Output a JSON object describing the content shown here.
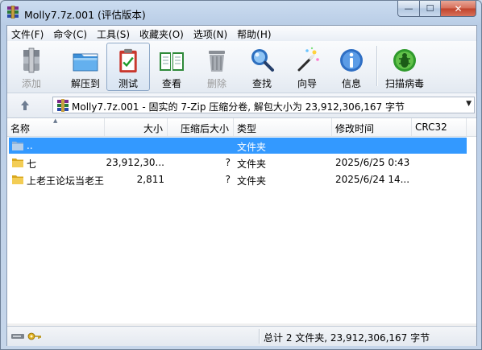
{
  "window": {
    "title": "Molly7.7z.001 (评估版本)",
    "minimize_glyph": "—",
    "maximize_glyph": "☐",
    "close_glyph": "✕"
  },
  "menu": [
    "文件(F)",
    "命令(C)",
    "工具(S)",
    "收藏夹(O)",
    "选项(N)",
    "帮助(H)"
  ],
  "toolbar": {
    "add": "添加",
    "extract": "解压到",
    "test": "测试",
    "view": "查看",
    "delete": "删除",
    "find": "查找",
    "wizard": "向导",
    "info": "信息",
    "virus_scan": "扫描病毒"
  },
  "address": {
    "text": "Molly7.7z.001 - 固实的 7-Zip 压缩分卷, 解包大小为 23,912,306,167 字节"
  },
  "columns": {
    "name": "名称",
    "size": "大小",
    "packed": "压缩后大小",
    "type": "类型",
    "modified": "修改时间",
    "crc": "CRC32"
  },
  "rows": [
    {
      "name": "..",
      "size": "",
      "packed": "",
      "type": "文件夹",
      "modified": "",
      "crc": ""
    },
    {
      "name": "七",
      "size": "23,912,30...",
      "packed": "?",
      "type": "文件夹",
      "modified": "2025/6/25 0:43",
      "crc": ""
    },
    {
      "name": "上老王论坛当老王",
      "size": "2,811",
      "packed": "?",
      "type": "文件夹",
      "modified": "2025/6/24 14...",
      "crc": ""
    }
  ],
  "status": {
    "summary": "总计 2 文件夹, 23,912,306,167 字节"
  },
  "colors": {
    "selection": "#3399ff",
    "close_button": "#c0422b"
  }
}
